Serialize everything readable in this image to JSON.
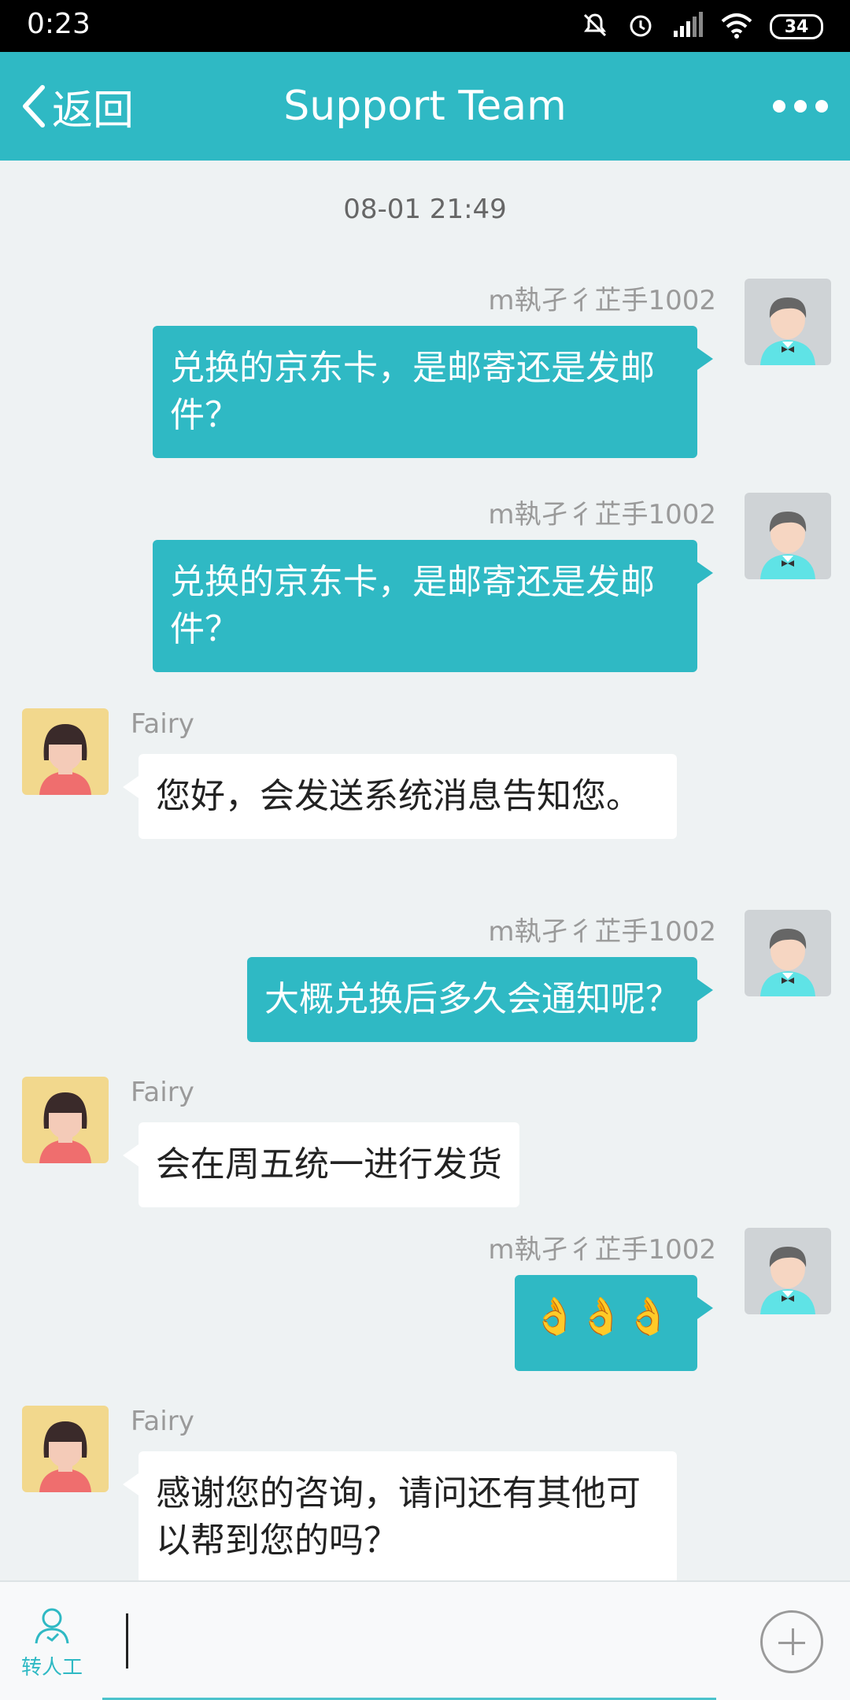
{
  "status": {
    "time": "0:23",
    "battery": "34"
  },
  "header": {
    "back_label": "返回",
    "title": "Support Team",
    "more_icon": "more-dots-icon"
  },
  "chat": {
    "timestamp": "08-01 21:49",
    "messages": [
      {
        "from": "user",
        "sender": "m執孑彳芷手1002",
        "text": "兑换的京东卡，是邮寄还是发邮件？"
      },
      {
        "from": "user",
        "sender": "m執孑彳芷手1002",
        "text": "兑换的京东卡，是邮寄还是发邮件？"
      },
      {
        "from": "agent",
        "sender": "Fairy",
        "text": "您好，会发送系统消息告知您。"
      },
      {
        "from": "user",
        "sender": "m執孑彳芷手1002",
        "text": "大概兑换后多久会通知呢？"
      },
      {
        "from": "agent",
        "sender": "Fairy",
        "text": "会在周五统一进行发货"
      },
      {
        "from": "user",
        "sender": "m執孑彳芷手1002",
        "text": "👌👌👌"
      },
      {
        "from": "agent",
        "sender": "Fairy",
        "text": "感谢您的咨询，请问还有其他可以帮到您的吗？"
      }
    ]
  },
  "input_bar": {
    "human_label": "转人工",
    "input_value": ""
  },
  "colors": {
    "accent": "#2fb9c4",
    "background": "#eef2f3"
  }
}
